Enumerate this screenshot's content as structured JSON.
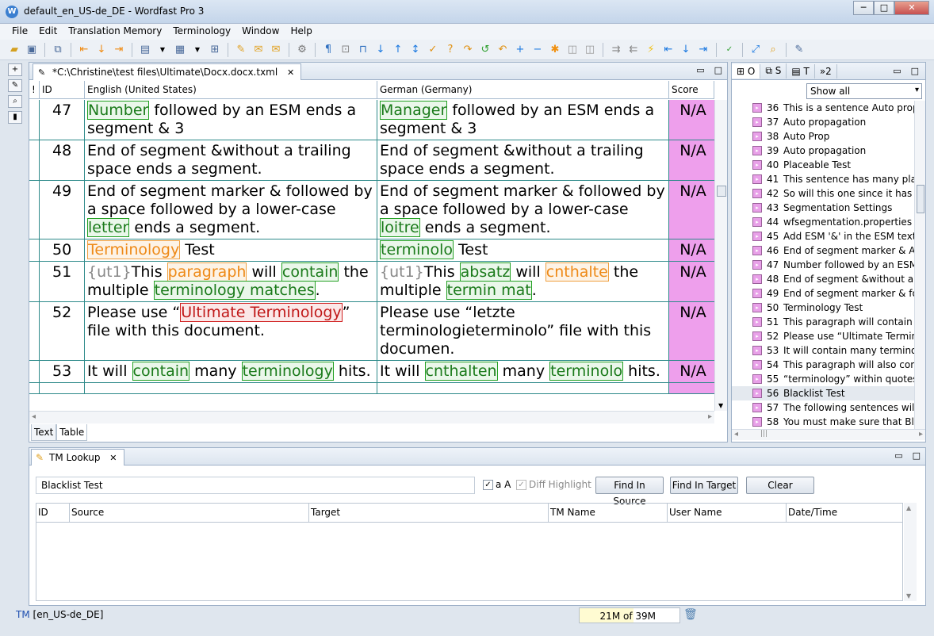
{
  "window": {
    "title": "default_en_US-de_DE - Wordfast Pro 3",
    "app_icon": "W",
    "min": "─",
    "max": "□",
    "close": "✕"
  },
  "menu": [
    "File",
    "Edit",
    "Translation Memory",
    "Terminology",
    "Window",
    "Help"
  ],
  "editor": {
    "tab_title": "*C:\\Christine\\test files\\Ultimate\\Docx.docx.txml",
    "tab_icon": "✎",
    "close_glyph": "✕",
    "min_glyph": "▭",
    "max_glyph": "□",
    "columns": {
      "flag": "!",
      "id": "ID",
      "source": "English (United States)",
      "target": "German (Germany)",
      "score": "Score"
    },
    "rows": [
      {
        "id": "47",
        "score": "N/A",
        "source": [
          {
            "t": "Number",
            "c": "green"
          },
          {
            "t": " followed by an ESM ends a segment & 3"
          }
        ],
        "target": [
          {
            "t": "Manager",
            "c": "green"
          },
          {
            "t": " followed by an ESM ends a segment & 3"
          }
        ]
      },
      {
        "id": "48",
        "score": "N/A",
        "source": [
          {
            "t": "End of segment &without a trailing space ends a segment."
          }
        ],
        "target": [
          {
            "t": "End of segment &without a trailing space ends a segment."
          }
        ]
      },
      {
        "id": "49",
        "score": "N/A",
        "source": [
          {
            "t": "End of segment marker & followed by a space followed by a lower-case "
          },
          {
            "t": "letter",
            "c": "green"
          },
          {
            "t": " ends a segment."
          }
        ],
        "target": [
          {
            "t": "End of segment marker & followed by a space followed by a lower-case "
          },
          {
            "t": "loitre",
            "c": "green"
          },
          {
            "t": " ends a segment."
          }
        ]
      },
      {
        "id": "50",
        "score": "N/A",
        "source": [
          {
            "t": "Terminology",
            "c": "orange"
          },
          {
            "t": " Test"
          }
        ],
        "target": [
          {
            "t": "terminolo",
            "c": "green"
          },
          {
            "t": " Test"
          }
        ]
      },
      {
        "id": "51",
        "score": "N/A",
        "source": [
          {
            "t": "{ut1}",
            "c": "gray"
          },
          {
            "t": "This "
          },
          {
            "t": "paragraph",
            "c": "orange"
          },
          {
            "t": " will "
          },
          {
            "t": "contain",
            "c": "green"
          },
          {
            "t": " the multiple "
          },
          {
            "t": "terminology matches",
            "c": "green"
          },
          {
            "t": "."
          }
        ],
        "target": [
          {
            "t": "{ut1}",
            "c": "gray"
          },
          {
            "t": "This "
          },
          {
            "t": "absatz",
            "c": "green"
          },
          {
            "t": " will "
          },
          {
            "t": "cnthalte",
            "c": "orange"
          },
          {
            "t": " the multiple "
          },
          {
            "t": "termin mat",
            "c": "green"
          },
          {
            "t": "."
          }
        ]
      },
      {
        "id": "52",
        "score": "N/A",
        "source": [
          {
            "t": "Please use “"
          },
          {
            "t": "Ultimate Terminology",
            "c": "red"
          },
          {
            "t": "” file with this document."
          }
        ],
        "target": [
          {
            "t": "Please use “letzte terminologieterminolo” file with this documen."
          }
        ]
      },
      {
        "id": "53",
        "score": "N/A",
        "source": [
          {
            "t": "It will "
          },
          {
            "t": "contain",
            "c": "green"
          },
          {
            "t": " many "
          },
          {
            "t": "terminology",
            "c": "green"
          },
          {
            "t": " hits."
          }
        ],
        "target": [
          {
            "t": "It will "
          },
          {
            "t": "cnthalten",
            "c": "green"
          },
          {
            "t": " many "
          },
          {
            "t": "terminolo",
            "c": "green"
          },
          {
            "t": " hits."
          }
        ]
      }
    ],
    "subtabs": [
      "Text",
      "Table"
    ],
    "scroll": {
      "up": "▲",
      "down": "▼",
      "left": "◂",
      "right": "▸"
    }
  },
  "right_panel": {
    "tabs": [
      "O",
      "S",
      "T",
      "»2"
    ],
    "filter": "Show all",
    "filter_arrow": "▾",
    "scroll_grip": "|||",
    "items": [
      {
        "n": "36",
        "t": "This is a sentence Auto propag"
      },
      {
        "n": "37",
        "t": "Auto propagation"
      },
      {
        "n": "38",
        "t": "Auto Prop"
      },
      {
        "n": "39",
        "t": "Auto propagation"
      },
      {
        "n": "40",
        "t": "Placeable Test"
      },
      {
        "n": "41",
        "t": "This sentence has many place"
      },
      {
        "n": "42",
        "t": "So will this one since it has m"
      },
      {
        "n": "43",
        "t": "Segmentation Settings"
      },
      {
        "n": "44",
        "t": "wfsegmentation.properties W"
      },
      {
        "n": "45",
        "t": "Add ESM '&' in the ESM textb"
      },
      {
        "n": "46",
        "t": "End of segment marker & Add"
      },
      {
        "n": "47",
        "t": "Number followed by an ESM e"
      },
      {
        "n": "48",
        "t": "End of segment &without a tr"
      },
      {
        "n": "49",
        "t": "End of segment marker & foll"
      },
      {
        "n": "50",
        "t": "Terminology Test"
      },
      {
        "n": "51",
        "t": "This paragraph will contain th"
      },
      {
        "n": "52",
        "t": "Please use “Ultimate Terminol"
      },
      {
        "n": "53",
        "t": "It will contain many terminolo"
      },
      {
        "n": "54",
        "t": "This paragraph will also conta"
      },
      {
        "n": "55",
        "t": "“terminology” within quotes a"
      },
      {
        "n": "56",
        "t": "Blacklist Test"
      },
      {
        "n": "57",
        "t": "The following sentences will c"
      },
      {
        "n": "58",
        "t": "You must make sure that Blac"
      }
    ],
    "selected": "56"
  },
  "tm_lookup": {
    "title": "TM Lookup",
    "search_value": "Blacklist Test",
    "case_label": "a A",
    "diff_label": "Diff Highlight",
    "check_glyph": "✓",
    "buttons": [
      "Find In Source",
      "Find In Target",
      "Clear"
    ],
    "columns": [
      "ID",
      "Source",
      "Target",
      "TM Name",
      "User Name",
      "Date/Time"
    ]
  },
  "status": {
    "tm_label": "TM",
    "locale": "[en_US-de_DE]",
    "memory": "21M of 39M",
    "memory_used_fraction": 0.54
  }
}
